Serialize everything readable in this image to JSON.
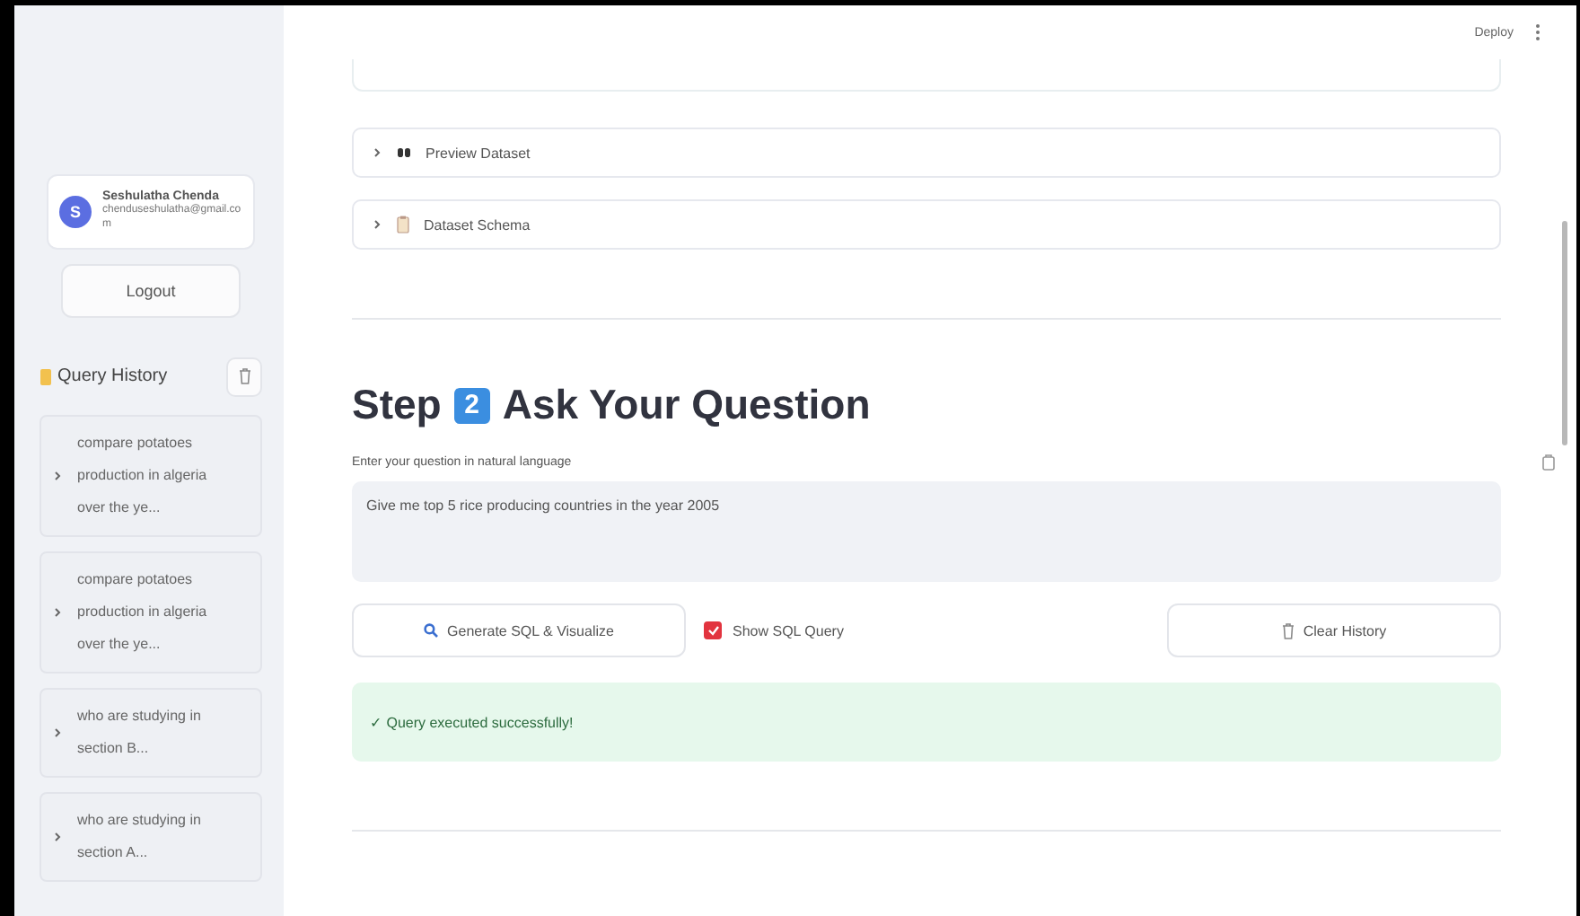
{
  "header": {
    "deploy": "Deploy"
  },
  "sidebar": {
    "user": {
      "initial": "S",
      "name": "Seshulatha Chenda",
      "email": "chenduseshulatha@gmail.com"
    },
    "logout": "Logout",
    "history_title": "Query History",
    "history": [
      {
        "text": "compare potatoes production in algeria over the ye...",
        "expanded": false
      },
      {
        "text": "compare potatoes production in algeria over the ye...",
        "expanded": false
      },
      {
        "text": "who are studying in section B...",
        "expanded": false
      },
      {
        "text": "who are studying in section A...",
        "expanded": false
      }
    ]
  },
  "expanders": [
    {
      "label": "Preview Dataset",
      "expanded": false
    },
    {
      "label": "Dataset Schema",
      "expanded": false
    }
  ],
  "step": {
    "prefix": "Step",
    "number": "2",
    "title": "Ask Your Question"
  },
  "question": {
    "label": "Enter your question in natural language",
    "value": "Give me top 5 rice producing countries in the year 2005"
  },
  "actions": {
    "generate": "Generate SQL & Visualize",
    "show_sql": {
      "label": "Show SQL Query",
      "checked": true
    },
    "clear": "Clear History"
  },
  "message": {
    "kind": "success",
    "text": "✓ Query executed successfully!"
  }
}
